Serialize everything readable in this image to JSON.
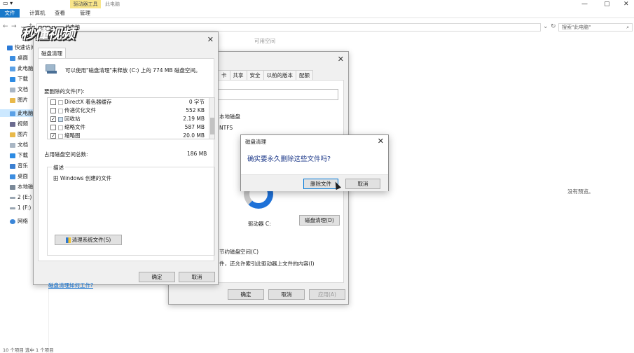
{
  "explorer": {
    "tabs": [
      "文件",
      "计算机",
      "查看",
      "管理"
    ],
    "drive_tools": "驱动器工具",
    "window_title": "此电脑",
    "address": "此电脑",
    "search_placeholder": "搜索\"此电脑\"",
    "column_free_space": "可用空间",
    "preview_text": "没有预览。",
    "status": "10 个项目    选中 1 个项目",
    "nav": [
      {
        "label": "快速访问"
      },
      {
        "label": "桌面"
      },
      {
        "label": "此电脑"
      },
      {
        "label": "下载"
      },
      {
        "label": "文档"
      },
      {
        "label": "图片"
      },
      {
        "label": "此电脑"
      },
      {
        "label": "视频"
      },
      {
        "label": "图片"
      },
      {
        "label": "文档"
      },
      {
        "label": "下载"
      },
      {
        "label": "音乐"
      },
      {
        "label": "桌面"
      },
      {
        "label": "本地磁盘"
      },
      {
        "label": "2 (E:)"
      },
      {
        "label": "1 (F:)"
      },
      {
        "label": "网络"
      }
    ],
    "colors": {
      "accent": "#1979ca",
      "drive_tools_bg": "#f8e58a",
      "selected_nav": "#cce8ff"
    }
  },
  "logo_text": "秒懂视频",
  "disk_cleanup": {
    "tab": "磁盘清理",
    "header": "可以使用\"磁盘清理\"来释放 (C:) 上的 774 MB 磁盘空间。",
    "files_label": "要删除的文件(F):",
    "files": [
      {
        "name": "DirectX 着色器缓存",
        "size": "0 字节",
        "checked": false,
        "check": ""
      },
      {
        "name": "传递优化文件",
        "size": "552 KB",
        "checked": false,
        "check": ""
      },
      {
        "name": "回收站",
        "size": "2.19 MB",
        "checked": true,
        "check": "✓"
      },
      {
        "name": "缩略文件",
        "size": "587 MB",
        "checked": false,
        "check": ""
      },
      {
        "name": "缩略图",
        "size": "20.0 MB",
        "checked": true,
        "check": "✓"
      }
    ],
    "total_label": "占用磁盘空间总数:",
    "total_value": "186 MB",
    "desc_title": "描述",
    "desc_text": "田 Windows 创建的文件",
    "clean_system_button": "清理系统文件(S)",
    "link": "磁盘清理如何工作?",
    "ok": "确定",
    "cancel": "取消"
  },
  "properties": {
    "tabs": [
      "卡",
      "共享",
      "安全",
      "以前的版本",
      "配额"
    ],
    "type_text": "本地磁盘",
    "fs_text": "NTFS",
    "drive_label": "驱动器 C:",
    "cleanup_button": "磁盘清理(D)",
    "compress_text": "节约磁盘空间(C)",
    "index_text": "件，还允许索引此驱动器上文件的内容(I)",
    "ok": "确定",
    "cancel": "取消",
    "apply": "应用(A)",
    "used_fraction": 0.62
  },
  "confirm": {
    "title": "磁盘清理",
    "question": "确实要永久删除这些文件吗?",
    "delete_button": "删除文件",
    "cancel_button": "取消"
  }
}
